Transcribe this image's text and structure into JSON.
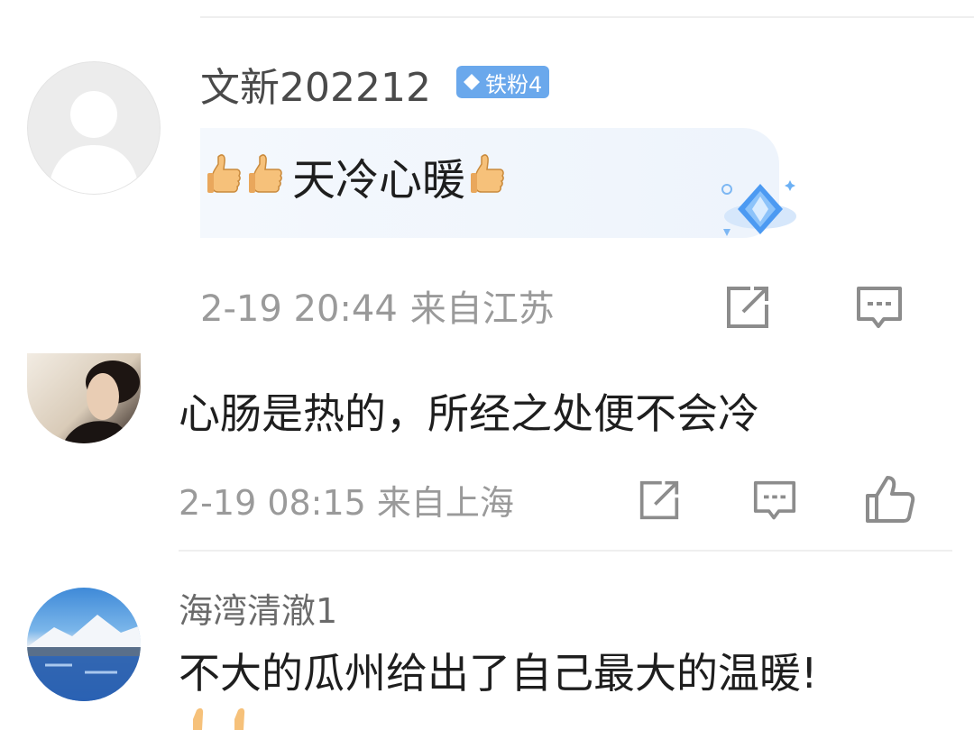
{
  "comments": [
    {
      "username": "文新202212",
      "badge": "铁粉4",
      "text": "天冷心暖",
      "time": "2-19 20:44",
      "location": "来自江苏"
    },
    {
      "text": "心肠是热的，所经之处便不会冷",
      "time": "2-19 08:15",
      "location": "来自上海"
    },
    {
      "username": "海湾清澈1",
      "text": "不大的瓜州给出了自己最大的温暖!"
    }
  ],
  "icons": [
    "share-icon",
    "comment-icon",
    "like-icon",
    "thumbs-up-emoji",
    "diamond-badge-icon"
  ],
  "colors": {
    "badge": "#6aa8ec",
    "meta": "#9a9a9a",
    "bubble": "#eef4fc"
  }
}
